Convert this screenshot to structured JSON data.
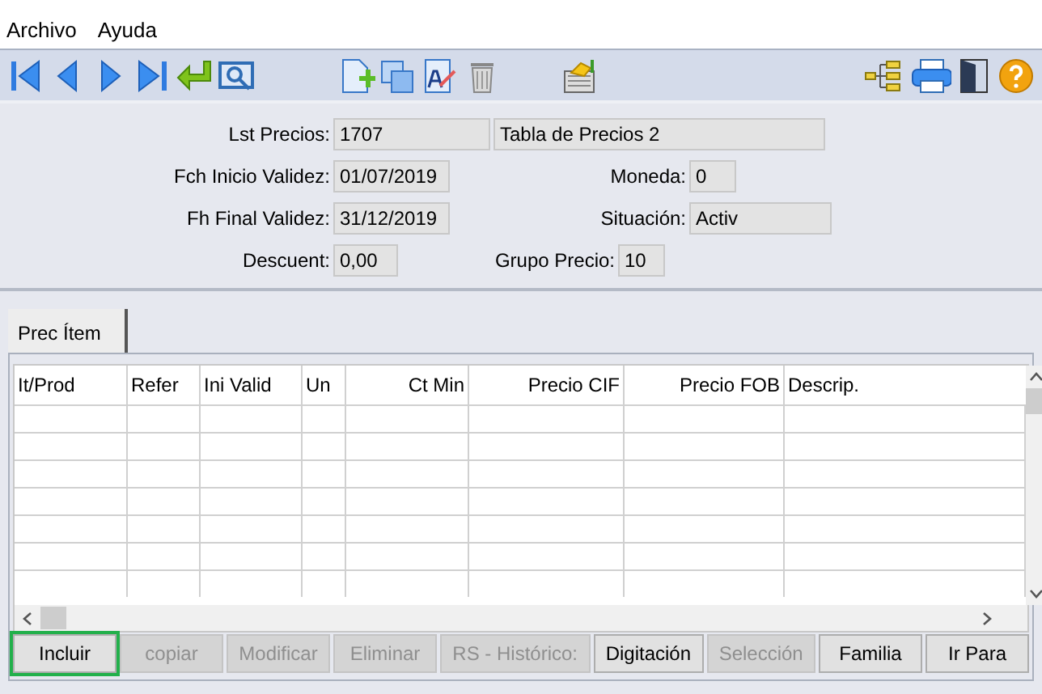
{
  "menu": [
    "Archivo",
    "Ayuda"
  ],
  "form": {
    "rows": [
      {
        "left": {
          "label": "Lst Precios:",
          "value": "1707",
          "extra": "Tabla de Precios 2"
        }
      },
      {
        "left": {
          "label": "Fch Inicio Validez:",
          "value": "01/07/2019"
        },
        "right": {
          "label": "Moneda:",
          "value": "0",
          "kind": "short"
        }
      },
      {
        "left": {
          "label": "Fh Final Validez:",
          "value": "31/12/2019"
        },
        "right": {
          "label": "Situación:",
          "value": "Activ",
          "kind": "wide"
        }
      },
      {
        "left": {
          "label": "Descuent:",
          "value": "0,00",
          "kind": "short"
        },
        "right": {
          "label": "Grupo Precio:",
          "value": "10",
          "kind": "short"
        }
      }
    ]
  },
  "tabs": [
    {
      "label": "Prec Ítem",
      "selected": true
    }
  ],
  "table": {
    "columns": [
      {
        "label": "It/Prod",
        "right_aligned": false
      },
      {
        "label": "Refer",
        "right_aligned": false
      },
      {
        "label": "Ini Valid",
        "right_aligned": false
      },
      {
        "label": "Un",
        "right_aligned": false
      },
      {
        "label": "Ct Min",
        "right_aligned": true
      },
      {
        "label": "Precio CIF",
        "right_aligned": true
      },
      {
        "label": "Precio FOB",
        "right_aligned": true
      },
      {
        "label": "Descrip.",
        "right_aligned": false
      }
    ]
  },
  "buttons": [
    {
      "label": "Incluir",
      "disabled": false,
      "selected": true
    },
    {
      "label": "copiar",
      "disabled": true,
      "selected": false
    },
    {
      "label": "Modificar",
      "disabled": true,
      "selected": false
    },
    {
      "label": "Eliminar",
      "disabled": true,
      "selected": false
    },
    {
      "label": "RS - Histórico:",
      "disabled": true,
      "selected": false
    },
    {
      "label": "Digitación",
      "disabled": false,
      "selected": false
    },
    {
      "label": "Selección",
      "disabled": true,
      "selected": false
    },
    {
      "label": "Familia",
      "disabled": false,
      "selected": false
    },
    {
      "label": "Ir Para",
      "disabled": false,
      "selected": false
    }
  ]
}
